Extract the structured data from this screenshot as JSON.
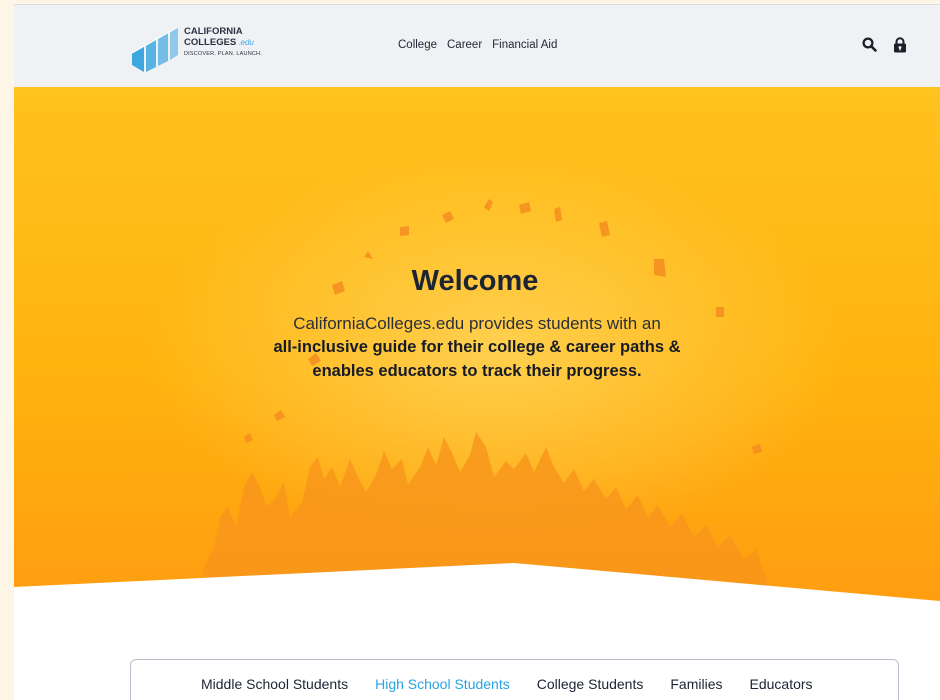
{
  "brand": {
    "name_line1": "CALIFORNIA",
    "name_line2": "COLLEGES",
    "name_suffix": ".edu",
    "tagline": "DISCOVER. PLAN. LAUNCH."
  },
  "nav": {
    "items": [
      {
        "label": "College"
      },
      {
        "label": "Career"
      },
      {
        "label": "Financial Aid"
      }
    ]
  },
  "header_tools": {
    "search_icon": "search-icon",
    "login_icon": "lock-icon"
  },
  "hero": {
    "title": "Welcome",
    "intro": "CaliforniaColleges.edu provides students with an",
    "lead_line1": "all-inclusive guide for their college & career paths &",
    "lead_line2": "enables educators to track their progress."
  },
  "audience_tabs": {
    "items": [
      {
        "label": "Middle School Students"
      },
      {
        "label": "High School Students"
      },
      {
        "label": "College Students"
      },
      {
        "label": "Families"
      },
      {
        "label": "Educators"
      }
    ],
    "active": "High School Students"
  },
  "colors": {
    "hero_top": "#ffc21f",
    "hero_mid": "#ffb30e",
    "hero_bottom": "#ff9d11",
    "active_tab": "#2aa3e0",
    "header_bg": "#eff1f5",
    "logo_blue": "#3ea7e0"
  }
}
